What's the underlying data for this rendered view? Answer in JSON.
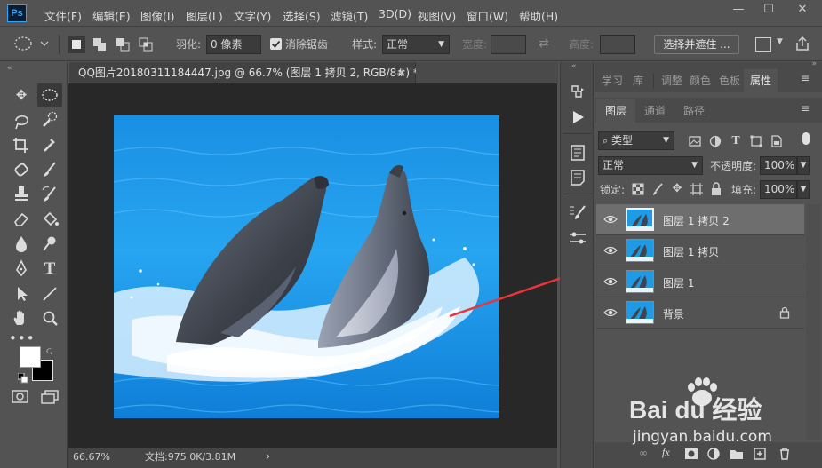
{
  "app": {
    "logo_text": "Ps"
  },
  "menu": [
    "文件(F)",
    "编辑(E)",
    "图像(I)",
    "图层(L)",
    "文字(Y)",
    "选择(S)",
    "滤镜(T)",
    "3D(D)",
    "视图(V)",
    "窗口(W)",
    "帮助(H)"
  ],
  "window_controls": {
    "minimize": "—",
    "maximize": "☐",
    "close": "✕"
  },
  "options": {
    "feather_label": "羽化:",
    "feather_value": "0 像素",
    "antialias_label": "消除锯齿",
    "antialias_checked": true,
    "style_label": "样式:",
    "style_value": "正常",
    "width_label": "宽度:",
    "height_label": "高度:",
    "select_mask_label": "选择并遮住 ..."
  },
  "document": {
    "tab_title": "QQ图片20180311184447.jpg @ 66.7% (图层 1 拷贝 2, RGB/8#) *",
    "close_glyph": "×",
    "zoom": "66.67%",
    "doc_info": "文档:975.0K/3.81M",
    "status_arrow": "›"
  },
  "panels": {
    "top_tabs": [
      "学习",
      "库",
      "调整",
      "颜色",
      "色板",
      "属性"
    ],
    "top_active": "属性",
    "layer_tabs": [
      "图层",
      "通道",
      "路径"
    ],
    "layer_active": "图层",
    "filter_kind": "类型",
    "blend_mode": "正常",
    "opacity_label": "不透明度:",
    "opacity_value": "100%",
    "lock_label": "锁定:",
    "fill_label": "填充:",
    "fill_value": "100%"
  },
  "layers": [
    {
      "name": "图层 1 拷贝 2",
      "selected": true,
      "locked": false
    },
    {
      "name": "图层 1 拷贝",
      "selected": false,
      "locked": false
    },
    {
      "name": "图层 1",
      "selected": false,
      "locked": false
    },
    {
      "name": "背景",
      "selected": false,
      "locked": true
    }
  ],
  "watermark": {
    "brand": "Bai du 经验",
    "url": "jingyan.baidu.com"
  },
  "colors": {
    "accent_blue": "#31a8ff",
    "arrow_red": "#e8353a",
    "water_blue": "#1f9be6"
  }
}
